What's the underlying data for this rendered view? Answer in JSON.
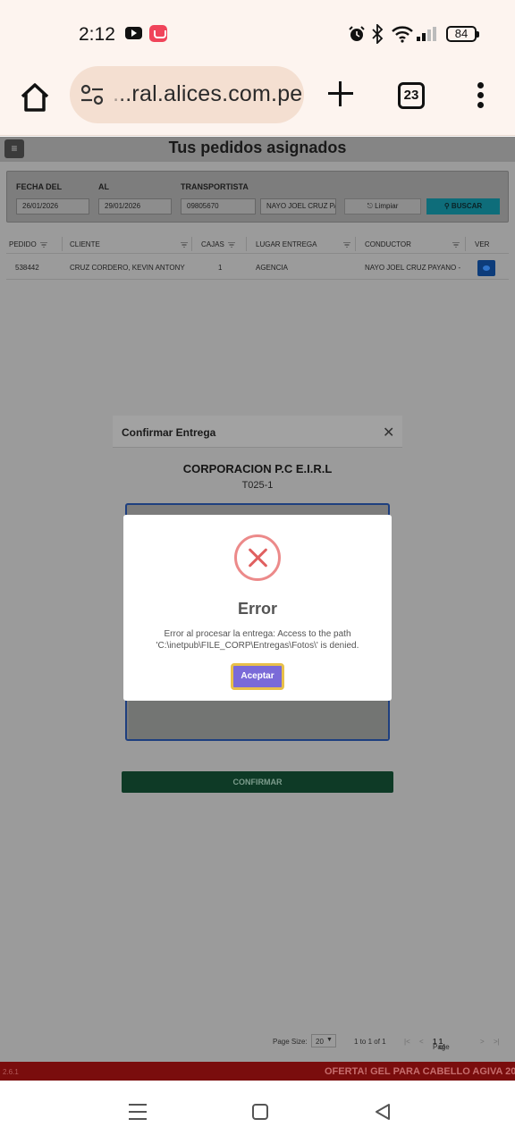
{
  "status_bar": {
    "time": "2:12",
    "icons": [
      "youtube-icon",
      "shop-icon",
      "alarm-icon",
      "bluetooth-icon",
      "wifi-icon",
      "signal-icon"
    ],
    "battery": "84"
  },
  "browser": {
    "url": "...ral.alices.com.pe",
    "tab_count": "23"
  },
  "page": {
    "title": "Tus pedidos asignados",
    "filters": {
      "fecha_del_label": "FECHA DEL",
      "fecha_del_value": "26/01/2026",
      "al_label": "AL",
      "al_value": "29/01/2026",
      "transportista_label": "TRANSPORTISTA",
      "transportista_value": "09805670",
      "driver_value": "NAYO JOEL CRUZ PA",
      "clear_label": "Limpiar",
      "search_label": "BUSCAR"
    },
    "grid": {
      "columns": [
        "PEDIDO",
        "CLIENTE",
        "CAJAS",
        "LUGAR ENTREGA",
        "CONDUCTOR",
        "VER"
      ],
      "rows": [
        {
          "pedido": "538442",
          "cliente": "CRUZ CORDERO, KEVIN ANTONY",
          "cajas": "1",
          "lugar": "AGENCIA",
          "conductor": "NAYO JOEL CRUZ PAYANO -"
        }
      ]
    },
    "pager": {
      "page_size_label": "Page Size:",
      "page_size_value": "20",
      "range": "1 to 1 of 1",
      "page_info_prefix": "Page",
      "page_current": "1",
      "page_of": "of",
      "page_total": "1"
    },
    "footer": {
      "version": "2.6.1",
      "promo": "OFERTA! GEL PARA CABELLO AGIVA 200"
    }
  },
  "modal": {
    "title": "Confirmar Entrega",
    "company": "CORPORACION P.C E.I.R.L",
    "order_code": "T025-1",
    "confirm_label": "CONFIRMAR"
  },
  "error_dialog": {
    "title": "Error",
    "message": "Error al procesar la entrega: Access to the path 'C:\\inetpub\\FILE_CORP\\Entregas\\Fotos\\' is denied.",
    "accept_label": "Aceptar"
  }
}
